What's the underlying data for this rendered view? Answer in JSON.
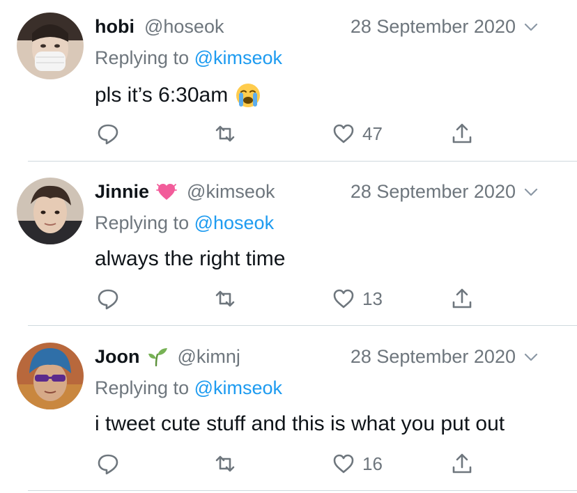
{
  "tweets": [
    {
      "name": "hobi",
      "handle": "@hoseok",
      "date": "28 September 2020",
      "reply_prefix": "Replying to ",
      "reply_to": "@kimseok",
      "text": "pls it’s 6:30am",
      "text_emoji": "loudly-crying-face",
      "name_emoji": null,
      "likes": "47"
    },
    {
      "name": "Jinnie",
      "handle": "@kimseok",
      "date": "28 September 2020",
      "reply_prefix": "Replying to ",
      "reply_to": "@hoseok",
      "text": "always the right time",
      "name_emoji": "beating-heart",
      "likes": "13"
    },
    {
      "name": "Joon",
      "handle": "@kimnj",
      "date": "28 September 2020",
      "reply_prefix": "Replying to ",
      "reply_to": "@kimseok",
      "text": "i tweet cute stuff and this is what you put out",
      "name_emoji": "seedling",
      "likes": "16"
    }
  ],
  "colors": {
    "text": "#0f1419",
    "secondary": "#6e767d",
    "link": "#1d9bf0",
    "divider": "#cfd9de"
  },
  "icons": [
    "reply-icon",
    "retweet-icon",
    "like-icon",
    "share-icon",
    "chevron-down-icon"
  ]
}
